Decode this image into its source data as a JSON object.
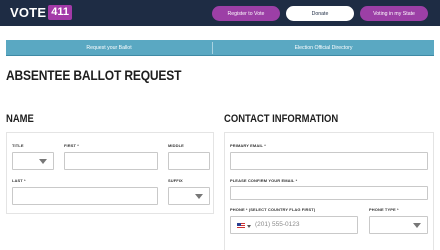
{
  "header": {
    "logo_text": "VOTE",
    "logo_badge": "411",
    "buttons": {
      "register": "Register to Vote",
      "donate": "Donate",
      "voting": "Voting in my State"
    },
    "colors": {
      "background": "#1e2c44",
      "accent": "#9c3fa6"
    }
  },
  "tabs": [
    {
      "label": "Request your Ballot"
    },
    {
      "label": "Election Official Directory"
    }
  ],
  "page": {
    "title": "ABSENTEE BALLOT REQUEST"
  },
  "name_section": {
    "heading": "NAME",
    "fields": {
      "title": {
        "label": "TITLE",
        "value": ""
      },
      "first": {
        "label": "FIRST *",
        "value": ""
      },
      "middle": {
        "label": "MIDDLE",
        "value": ""
      },
      "last": {
        "label": "LAST *",
        "value": ""
      },
      "suffix": {
        "label": "SUFFIX",
        "value": ""
      }
    }
  },
  "contact_section": {
    "heading": "CONTACT INFORMATION",
    "fields": {
      "primary_email": {
        "label": "PRIMARY EMAIL *",
        "value": ""
      },
      "confirm_email": {
        "label": "PLEASE CONFIRM YOUR EMAIL *",
        "value": ""
      },
      "phone": {
        "label": "PHONE * (SELECT COUNTRY FLAG FIRST)",
        "placeholder": "(201) 555-0123",
        "flag_icon": "us-flag-icon"
      },
      "phone_type": {
        "label": "PHONE TYPE *",
        "value": ""
      }
    }
  },
  "colors": {
    "tab_bar": "#5aa8c2"
  }
}
